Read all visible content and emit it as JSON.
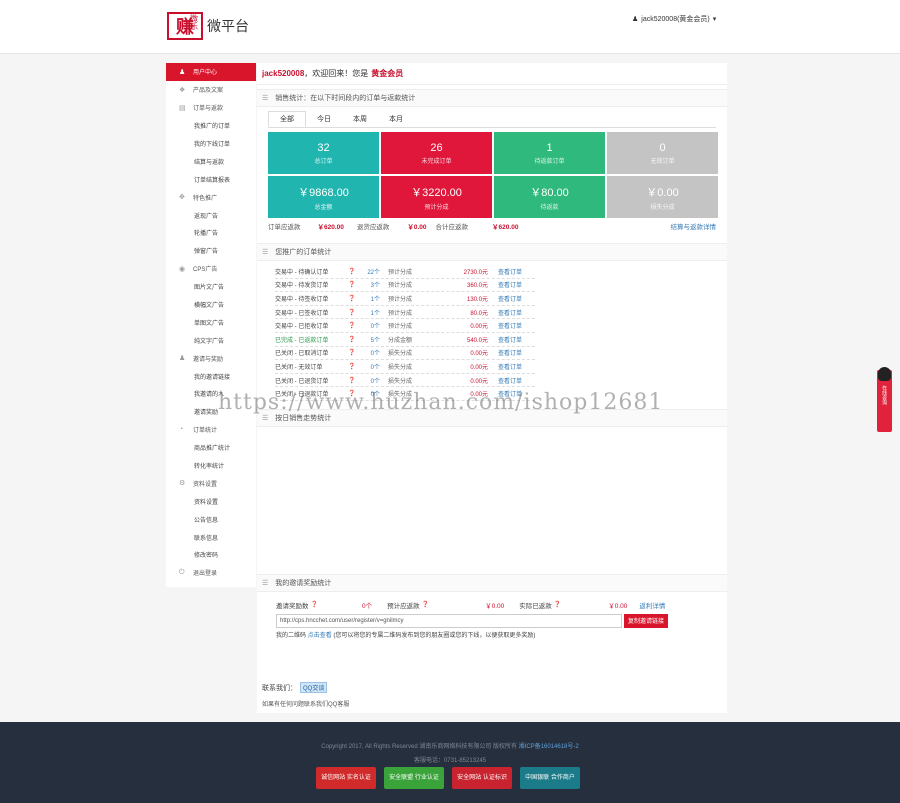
{
  "header": {
    "logo_char": "赚",
    "logo_sub": "微乐",
    "logo_text": "微平台",
    "user_label": "jack520008(黄金会员)",
    "user_icon": "user-icon",
    "caret": "▾"
  },
  "sidebar": {
    "items": [
      {
        "label": "用户中心",
        "icon": "user-icon",
        "active": true
      },
      {
        "label": "产品及文案",
        "icon": "cubes-icon"
      },
      {
        "label": "订单与返款",
        "icon": "file-icon"
      },
      {
        "label": "我推广的订单",
        "sub": true
      },
      {
        "label": "我的下线订单",
        "sub": true
      },
      {
        "label": "结算与返款",
        "sub": true
      },
      {
        "label": "订单结算报表",
        "sub": true
      },
      {
        "label": "特色推广",
        "icon": "arrows-icon"
      },
      {
        "label": "返现广告",
        "sub": true
      },
      {
        "label": "轮播广告",
        "sub": true
      },
      {
        "label": "弹窗广告",
        "sub": true
      },
      {
        "label": "CPS广告",
        "icon": "eye-icon"
      },
      {
        "label": "图片文广告",
        "sub": true
      },
      {
        "label": "横幅文广告",
        "sub": true
      },
      {
        "label": "单图文广告",
        "sub": true
      },
      {
        "label": "纯文字广告",
        "sub": true
      },
      {
        "label": "邀请与奖励",
        "icon": "users-icon"
      },
      {
        "label": "我的邀请链接",
        "sub": true
      },
      {
        "label": "我邀请的人",
        "sub": true
      },
      {
        "label": "邀请奖励",
        "sub": true
      },
      {
        "label": "订单统计",
        "icon": "pie-icon"
      },
      {
        "label": "商品推广统计",
        "sub": true
      },
      {
        "label": "转化率统计",
        "sub": true
      },
      {
        "label": "资料设置",
        "icon": "gear-icon"
      },
      {
        "label": "资料设置",
        "sub": true
      },
      {
        "label": "公告信息",
        "sub": true
      },
      {
        "label": "联系信息",
        "sub": true
      },
      {
        "label": "修改密码",
        "sub": true
      },
      {
        "label": "退出登录",
        "icon": "power-icon"
      }
    ]
  },
  "welcome": {
    "username": "jack520008",
    "text": "，欢迎回来！您是",
    "level": "黄金会员"
  },
  "sales": {
    "title": "销售统计：在以下时间段内的订单与返款统计",
    "tabs": [
      "全部",
      "今日",
      "本周",
      "本月"
    ],
    "cells": [
      {
        "value": "32",
        "label": "总订单",
        "color": "#21b5b0"
      },
      {
        "value": "26",
        "label": "未完成订单",
        "color": "#e0163a"
      },
      {
        "value": "1",
        "label": "待返款订单",
        "color": "#2fb97c"
      },
      {
        "value": "0",
        "label": "无效订单",
        "color": "#c4c4c4"
      },
      {
        "value": "￥9868.00",
        "label": "总金额",
        "color": "#21b5b0"
      },
      {
        "value": "￥3220.00",
        "label": "预计分成",
        "color": "#e0163a"
      },
      {
        "value": "￥80.00",
        "label": "待返款",
        "color": "#2fb97c"
      },
      {
        "value": "￥0.00",
        "label": "损失分成",
        "color": "#c4c4c4"
      }
    ],
    "refund": {
      "l1": "订单应返款",
      "v1": "￥620.00",
      "l2": "退货应返款",
      "v2": "￥0.00",
      "l3": "合计应返款",
      "v3": "￥620.00",
      "link": "结算与返款详情"
    }
  },
  "promo": {
    "title": "您推广的订单统计",
    "rows": [
      {
        "status": "交易中 - 待确认订单",
        "count": "22个",
        "type": "预计分成",
        "amount": "2730.0元",
        "link": "查看订单",
        "green": false
      },
      {
        "status": "交易中 - 待发货订单",
        "count": "3个",
        "type": "预计分成",
        "amount": "360.0元",
        "link": "查看订单",
        "green": false
      },
      {
        "status": "交易中 - 待签收订单",
        "count": "1个",
        "type": "预计分成",
        "amount": "130.0元",
        "link": "查看订单",
        "green": false
      },
      {
        "status": "交易中 - 已签收订单",
        "count": "1个",
        "type": "预计分成",
        "amount": "80.0元",
        "link": "查看订单",
        "green": false
      },
      {
        "status": "交易中 - 已拒收订单",
        "count": "0个",
        "type": "预计分成",
        "amount": "0.00元",
        "link": "查看订单",
        "green": false
      },
      {
        "status": "已完成 - 已返款订单",
        "count": "5个",
        "type": "分成金额",
        "amount": "540.0元",
        "link": "查看订单",
        "green": true
      },
      {
        "status": "已关闭 - 已取消订单",
        "count": "0个",
        "type": "损失分成",
        "amount": "0.00元",
        "link": "查看订单",
        "green": false
      },
      {
        "status": "已关闭 - 无效订单",
        "count": "0个",
        "type": "损失分成",
        "amount": "0.00元",
        "link": "查看订单",
        "green": false
      },
      {
        "status": "已关闭 - 已退货订单",
        "count": "0个",
        "type": "损失分成",
        "amount": "0.00元",
        "link": "查看订单",
        "green": false
      },
      {
        "status": "已关闭 - 已退款订单",
        "count": "0个",
        "type": "损失分成",
        "amount": "0.00元",
        "link": "查看订单",
        "green": false
      }
    ]
  },
  "chart_section": {
    "title": "按日销售走势统计"
  },
  "invite": {
    "title": "我的邀请奖励统计",
    "l1": "邀请奖励数",
    "v1": "0个",
    "l2": "预计应返款",
    "v2": "￥0.00",
    "l3": "实际已返款",
    "v3": "￥0.00",
    "link": "返利详情",
    "url": "http://cps.hncchet.com/user/register/v=gnilmcy",
    "copy": "复制邀请链接",
    "tip_label": "我的二维码",
    "tip_link": "点击查看",
    "tip_text": "(您可以将您的专属二维码发布到您的朋友圈或您的下线，以便获取更多奖励)"
  },
  "contact": {
    "label": "联系我们：",
    "qq": "QQ交谈",
    "note": "如果有任何问题联系我们QQ客服"
  },
  "footer": {
    "copyright": "Copyright 2017, All Rights Reserved 湖南乐商网络科技有限公司 版权所有",
    "icp": "湘ICP备16014618号-2",
    "phone": "客服电话：0731-85213245",
    "badges": [
      {
        "text": "诚信网站 实名认证",
        "color": "#d02a2a"
      },
      {
        "text": "安全联盟 行业认证",
        "color": "#3aa33a"
      },
      {
        "text": "安全网站 认证标识",
        "color": "#c8232f"
      },
      {
        "text": "中国银联 合作商户",
        "color": "#1b7b88"
      }
    ]
  },
  "watermark": "https://www.huzhan.com/ishop12681",
  "qq_float": {
    "text": "在线咨询"
  }
}
